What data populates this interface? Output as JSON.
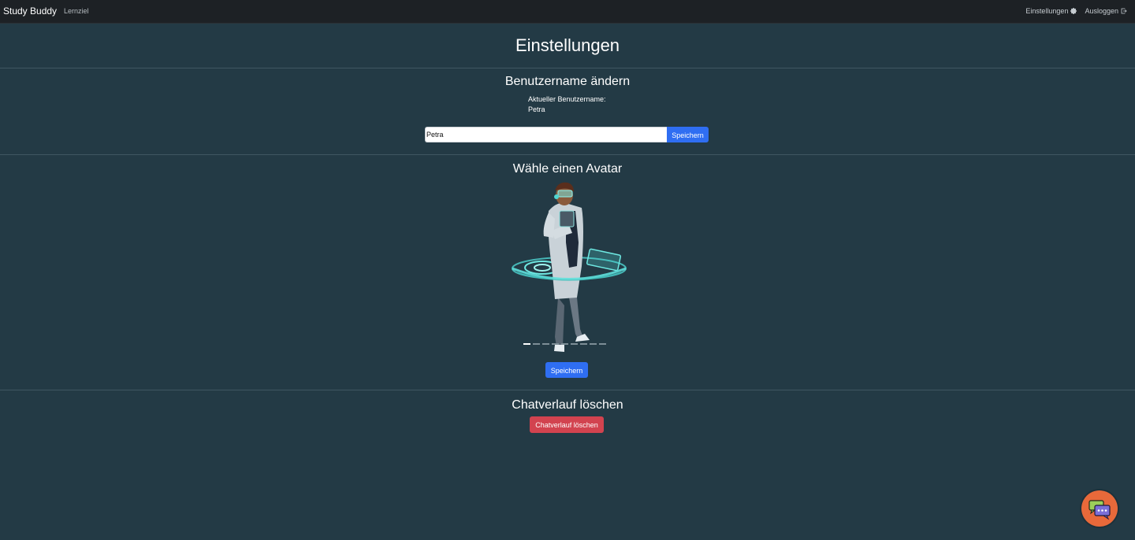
{
  "navbar": {
    "brand": "Study Buddy",
    "links": [
      {
        "label": "Lernziel"
      }
    ],
    "right": [
      {
        "label": "Einstellungen",
        "icon": "gear-icon"
      },
      {
        "label": "Ausloggen",
        "icon": "logout-icon"
      }
    ]
  },
  "page": {
    "title": "Einstellungen"
  },
  "username_section": {
    "heading": "Benutzername ändern",
    "current_label": "Aktueller Benutzername:",
    "current_value": "Petra",
    "input_value": "Petra",
    "save_label": "Speichern"
  },
  "avatar_section": {
    "heading": "Wähle einen Avatar",
    "slide_count": 9,
    "active_slide": 1,
    "save_label": "Speichern"
  },
  "chat_section": {
    "heading": "Chatverlauf löschen",
    "delete_label": "Chatverlauf löschen"
  },
  "colors": {
    "background": "#233a45",
    "navbar": "#1d2125",
    "primary": "#2f6ef2",
    "danger": "#d2434f",
    "chat_fab": "#e8693a"
  }
}
